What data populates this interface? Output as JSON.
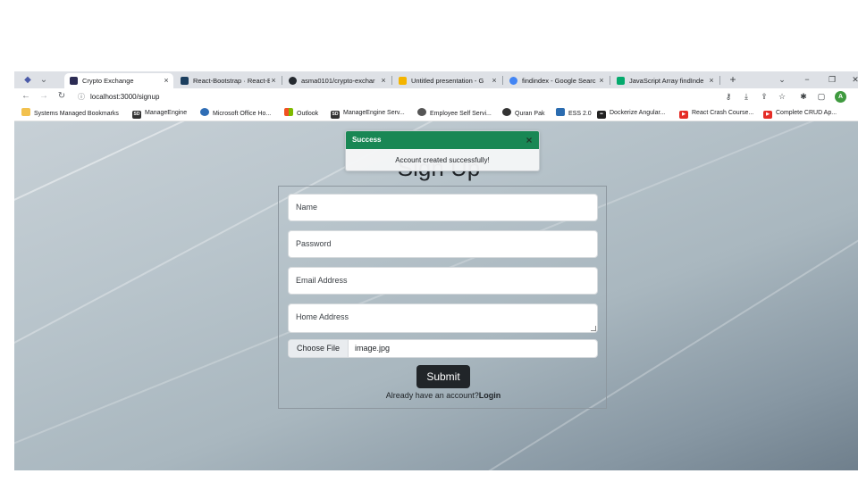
{
  "browser": {
    "tabs": [
      {
        "title": "Crypto Exchange",
        "active": true,
        "favicon_color": "#2c2c54"
      },
      {
        "title": "React-Bootstrap · React-B",
        "favicon_color": "#1c3f5f"
      },
      {
        "title": "asma0101/crypto-exchar",
        "favicon_color": "#24292f"
      },
      {
        "title": "Untitled presentation - G",
        "favicon_color": "#f4b400"
      },
      {
        "title": "findindex - Google Searc",
        "favicon_color": "#4285f4"
      },
      {
        "title": "JavaScript Array findInde",
        "favicon_color": "#04aa6d"
      }
    ],
    "new_tab": "+",
    "close_glyph": "×",
    "url": "localhost:3000/signup",
    "profile_initial": "A"
  },
  "bookmarks": [
    {
      "label": "Systems Managed Bookmarks",
      "icon": "folder-icon",
      "color": "#f2c14e",
      "glyph": ""
    },
    {
      "label": "ManageEngine",
      "icon": "sd-icon",
      "color": "#333333",
      "glyph": "SD"
    },
    {
      "label": "Microsoft Office Ho...",
      "icon": "office-icon",
      "color": "#2f6db5",
      "glyph": ""
    },
    {
      "label": "Outlook",
      "icon": "windows-icon",
      "color": "#f25022",
      "glyph": ""
    },
    {
      "label": "ManageEngine Serv...",
      "icon": "sd-icon",
      "color": "#333333",
      "glyph": "SD"
    },
    {
      "label": "Employee Self Servi...",
      "icon": "globe-icon",
      "color": "#555555",
      "glyph": ""
    },
    {
      "label": "Quran Pak",
      "icon": "circle-icon",
      "color": "#333333",
      "glyph": ""
    },
    {
      "label": "ESS 2.0",
      "icon": "check-icon",
      "color": "#2b6cb0",
      "glyph": ""
    },
    {
      "label": "Dockerize Angular...",
      "icon": "dots-icon",
      "color": "#222222",
      "glyph": "••"
    },
    {
      "label": "React Crash Course...",
      "icon": "youtube-icon",
      "color": "#e52d27",
      "glyph": "▶"
    },
    {
      "label": "Complete CRUD Ap...",
      "icon": "youtube-icon",
      "color": "#e52d27",
      "glyph": "▶"
    }
  ],
  "page": {
    "title": "Sign Up",
    "fields": {
      "name_placeholder": "Name",
      "password_placeholder": "Password",
      "email_placeholder": "Email Address",
      "address_placeholder": "Home Address"
    },
    "file": {
      "button_label": "Choose File",
      "file_name": "image.jpg"
    },
    "submit_label": "Submit",
    "login_prompt": "Already have an account?",
    "login_link": "Login"
  },
  "toast": {
    "header": "Success",
    "close_glyph": "×",
    "message": "Account created successfully!",
    "header_color": "#198754"
  }
}
